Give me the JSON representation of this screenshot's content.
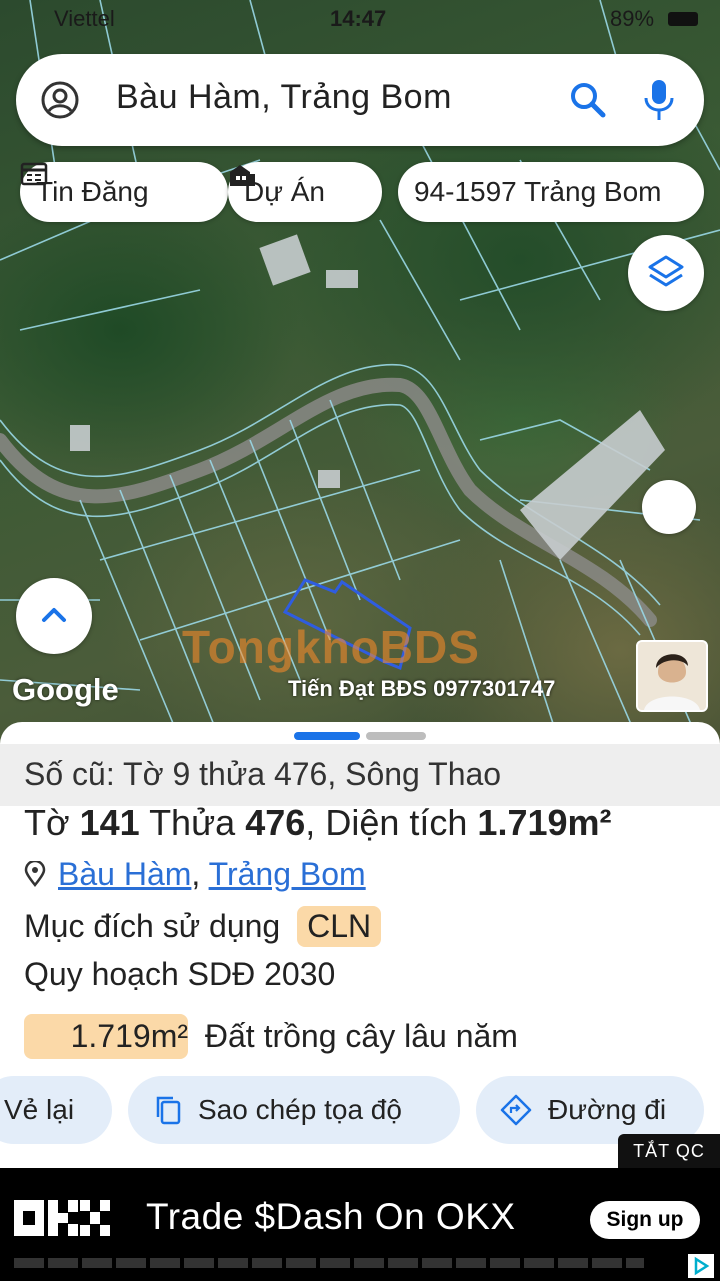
{
  "status_bar": {
    "carrier": "Viettel",
    "time": "14:47",
    "battery": "89%"
  },
  "search": {
    "query": "Bàu Hàm, Trảng Bom"
  },
  "chips": [
    {
      "label": "Tin Đăng",
      "icon": "calendar-list-icon"
    },
    {
      "label": "Dự Án",
      "icon": "buildings-icon"
    },
    {
      "label": "94-1597 Trảng Bom",
      "icon": ""
    }
  ],
  "map": {
    "attribution": "Google",
    "watermark": "TongkhoBDS",
    "credit": "Tiến Đạt BĐS 0977301747",
    "parcel_color": "#2f5de0"
  },
  "parcel": {
    "old_info": "Số cũ: Tờ 9 thửa 476, Sông Thao",
    "sheet_label": "Tờ",
    "sheet_no": "141",
    "plot_label": "Thửa",
    "plot_no": "476",
    "area_label": "Diện tích",
    "area": "1.719m²",
    "location_commune": "Bàu Hàm",
    "location_district": "Trảng Bom",
    "usage_label": "Mục đích sử dụng",
    "usage_code": "CLN",
    "plan_label": "Quy hoạch SDĐ 2030",
    "plan_area": "1.719m²",
    "plan_desc": "Đất trồng cây lâu năm"
  },
  "actions": [
    {
      "label": "Vẻ lại",
      "icon": ""
    },
    {
      "label": "Sao chép tọa độ",
      "icon": "copy-icon"
    },
    {
      "label": "Đường đi",
      "icon": "directions-icon"
    }
  ],
  "ad": {
    "close_label": "TẮT QC",
    "brand": "OKX",
    "message": "Trade $Dash On OKX",
    "cta": "Sign up"
  }
}
